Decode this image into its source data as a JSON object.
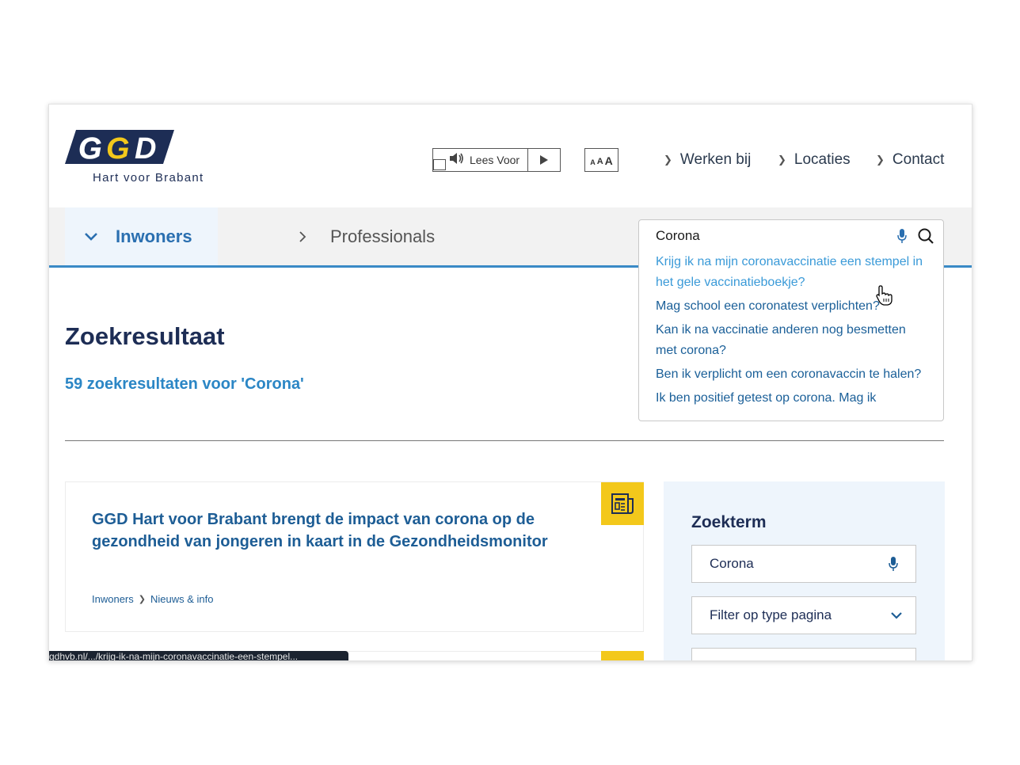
{
  "brand": {
    "logo_text": "GGD",
    "subtitle": "Hart voor Brabant"
  },
  "toolbar": {
    "read_aloud_label": "Lees Voor",
    "text_size_letters": [
      "A",
      "A",
      "A"
    ]
  },
  "top_nav": [
    {
      "label": "Werken bij"
    },
    {
      "label": "Locaties"
    },
    {
      "label": "Contact"
    }
  ],
  "main_nav": {
    "active_tab": "Inwoners",
    "other_tab": "Professionals"
  },
  "search": {
    "value": "Corona",
    "suggestions": [
      "Krijg ik na mijn coronavaccinatie een stempel in het gele vaccinatieboekje?",
      "Mag school een coronatest verplichten?",
      "Kan ik na vaccinatie anderen nog besmetten met corona?",
      "Ben ik verplicht om een coronavaccin te halen?",
      "Ik ben positief getest op corona. Mag ik"
    ]
  },
  "results": {
    "heading": "Zoekresultaat",
    "count_text": "59 zoekresultaten voor 'Corona'",
    "items": [
      {
        "title": "GGD Hart voor Brabant brengt de impact van corona op de gezondheid van jongeren in kaart in de Gezondheidsmonitor",
        "breadcrumb": [
          "Inwoners",
          "Nieuws & info"
        ],
        "icon": "newspaper-icon"
      }
    ]
  },
  "status_bar": {
    "url": "gdhvb.nl/.../krijg-ik-na-mijn-coronavaccinatie-een-stempel..."
  },
  "sidebar": {
    "title": "Zoekterm",
    "input_value": "Corona",
    "filter_label": "Filter op type pagina"
  },
  "colors": {
    "primary_blue": "#1d5d95",
    "accent_blue": "#3a8ac6",
    "badge_yellow": "#f3c81b",
    "navy": "#1d2d55"
  }
}
